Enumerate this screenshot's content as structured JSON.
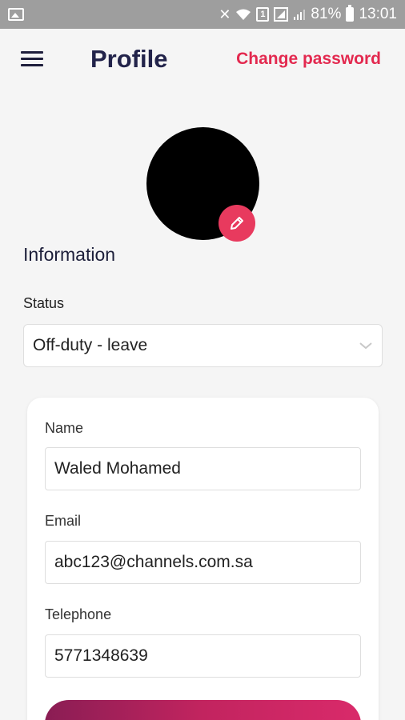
{
  "status_bar": {
    "battery": "81%",
    "time": "13:01",
    "icons": [
      "image-icon",
      "mute-icon",
      "wifi-icon",
      "sim-icon",
      "signal-icon",
      "battery-icon"
    ]
  },
  "header": {
    "title": "Profile",
    "action": "Change password"
  },
  "section": {
    "title": "Information"
  },
  "status": {
    "label": "Status",
    "value": "Off-duty - leave"
  },
  "form": {
    "name_label": "Name",
    "name_value": "Waled Mohamed",
    "email_label": "Email",
    "email_value": "abc123@channels.com.sa",
    "telephone_label": "Telephone",
    "telephone_value": "5771348639"
  },
  "colors": {
    "accent": "#e3294f",
    "title": "#22234a",
    "status_bar": "#9e9e9e"
  }
}
